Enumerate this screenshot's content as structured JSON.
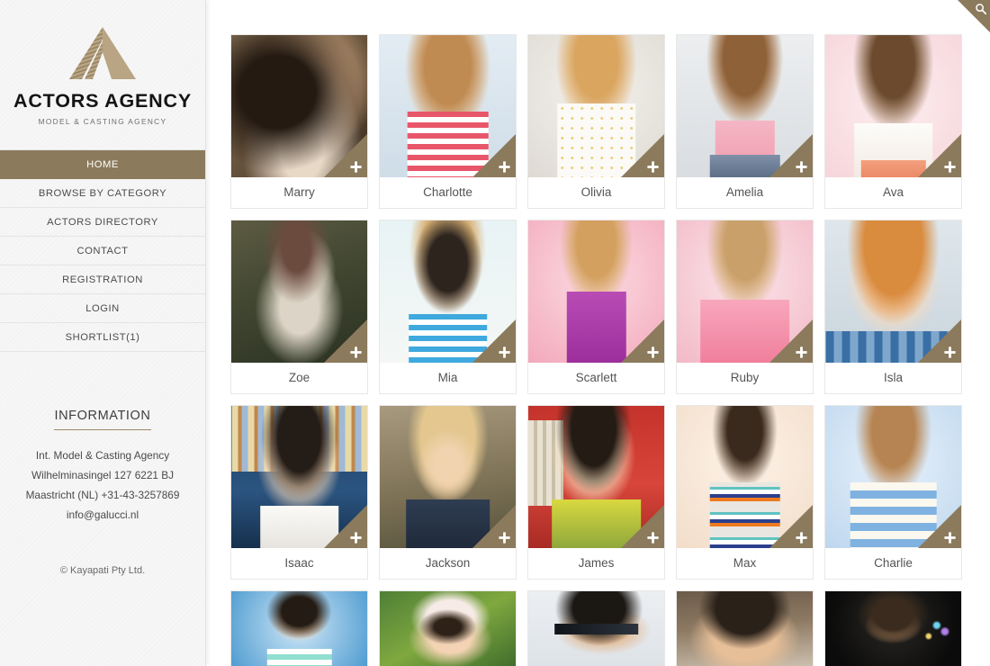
{
  "brand": {
    "logo_icon": "triangle-a-logo-icon",
    "title": "ACTORS AGENCY",
    "subtitle": "MODEL & CASTING AGENCY"
  },
  "colors": {
    "accent": "#8b7a5c",
    "sidebar_bg": "#f6f6f6",
    "page_bg": "#ffffff",
    "text": "#4a4a4a",
    "active_nav_text": "#ffffff"
  },
  "sidebar": {
    "nav": [
      {
        "label": "HOME",
        "active": true
      },
      {
        "label": "BROWSE BY CATEGORY",
        "active": false
      },
      {
        "label": "ACTORS DIRECTORY",
        "active": false
      },
      {
        "label": "CONTACT",
        "active": false
      },
      {
        "label": "REGISTRATION",
        "active": false
      },
      {
        "label": "LOGIN",
        "active": false
      },
      {
        "label": "SHORTLIST(1)",
        "active": false
      }
    ],
    "information": {
      "heading": "INFORMATION",
      "lines": [
        "Int. Model & Casting Agency",
        "Wilhelminasingel 127 6221 BJ",
        "Maastricht (NL) +31-43-3257869",
        "info@galucci.nl"
      ]
    },
    "copyright": "© Kayapati Pty Ltd."
  },
  "header": {
    "search_icon": "search-icon",
    "search_corner_label": "Search"
  },
  "main": {
    "add_icon": "plus-icon",
    "rows": [
      [
        {
          "name": "Marry",
          "photo": "portrait-woman-glasses-sepia"
        },
        {
          "name": "Charlotte",
          "photo": "portrait-girl-striped-top-light-blue"
        },
        {
          "name": "Olivia",
          "photo": "portrait-girl-white-dotted-dress"
        },
        {
          "name": "Amelia",
          "photo": "portrait-girl-pink-tank-top"
        },
        {
          "name": "Ava",
          "photo": "portrait-girl-white-lace-top-pink-bg"
        }
      ],
      [
        {
          "name": "Zoe",
          "photo": "portrait-girl-forest-sitting"
        },
        {
          "name": "Mia",
          "photo": "portrait-toddler-straw-hat-stripes"
        },
        {
          "name": "Scarlett",
          "photo": "portrait-girl-purple-dress-pink-bg"
        },
        {
          "name": "Ruby",
          "photo": "portrait-girl-pink-sweater-arms-crossed"
        },
        {
          "name": "Isla",
          "photo": "portrait-boy-red-hair-plaid-shirt"
        }
      ],
      [
        {
          "name": "Isaac",
          "photo": "portrait-boy-bookshelf-white-tee"
        },
        {
          "name": "Jackson",
          "photo": "portrait-boy-cowboy-hat-outdoors"
        },
        {
          "name": "James",
          "photo": "portrait-boy-round-glasses-red-bg"
        },
        {
          "name": "Max",
          "photo": "portrait-boy-striped-sweater-cream-bg"
        },
        {
          "name": "Charlie",
          "photo": "portrait-boy-blue-stripes-blue-bg"
        }
      ],
      [
        {
          "name": "",
          "photo": "portrait-boy-mint-stripes-blue-bg"
        },
        {
          "name": "",
          "photo": "portrait-toddler-white-beanie-plants"
        },
        {
          "name": "",
          "photo": "portrait-man-sunglasses-light-bg"
        },
        {
          "name": "",
          "photo": "portrait-man-cafe-closeup"
        },
        {
          "name": "",
          "photo": "portrait-man-beard-dark-bg"
        }
      ]
    ]
  }
}
